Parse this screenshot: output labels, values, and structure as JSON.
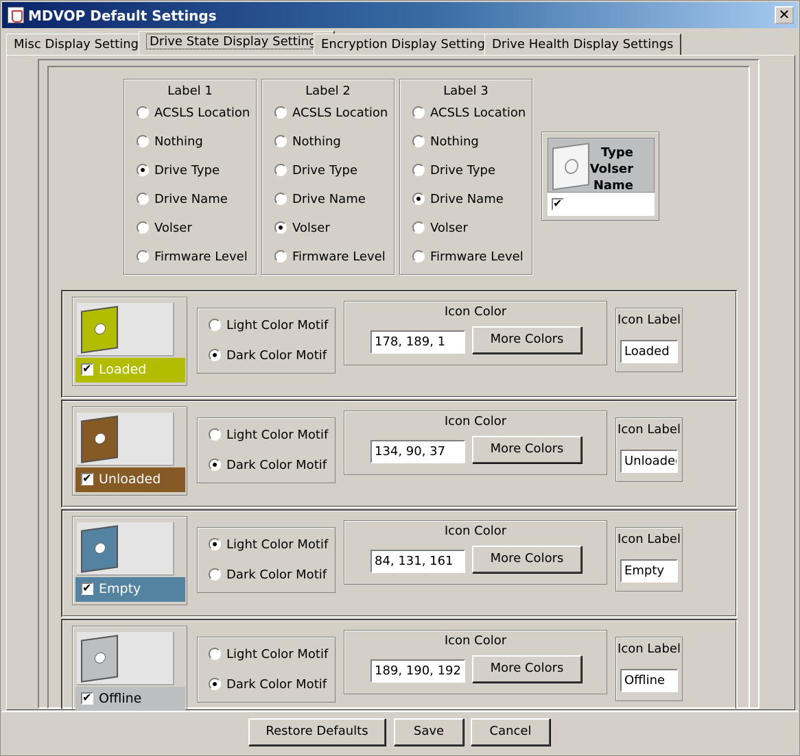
{
  "window": {
    "title": "MDVOP Default Settings",
    "close_glyph": "✕"
  },
  "tabs": [
    {
      "label": "Misc Display Settings",
      "active": false
    },
    {
      "label": "Drive State Display Settings",
      "active": true
    },
    {
      "label": "Encryption Display Settings",
      "active": false
    },
    {
      "label": "Drive Health Display Settings",
      "active": false
    }
  ],
  "label_groups": [
    {
      "title": "Label 1",
      "options": [
        "ACSLS Location",
        "Nothing",
        "Drive Type",
        "Drive Name",
        "Volser",
        "Firmware Level"
      ],
      "selected": "Drive Type"
    },
    {
      "title": "Label 2",
      "options": [
        "ACSLS Location",
        "Nothing",
        "Drive Type",
        "Drive Name",
        "Volser",
        "Firmware Level"
      ],
      "selected": "Volser"
    },
    {
      "title": "Label 3",
      "options": [
        "ACSLS Location",
        "Nothing",
        "Drive Type",
        "Drive Name",
        "Volser",
        "Firmware Level"
      ],
      "selected": "Drive Name"
    }
  ],
  "preview": {
    "lines": [
      "Type",
      "Volser",
      "Name"
    ],
    "checked": true
  },
  "motif_labels": {
    "light": "Light Color Motif",
    "dark": "Dark Color Motif"
  },
  "icon_color_title": "Icon Color",
  "icon_label_title": "Icon Label",
  "more_colors_label": "More Colors",
  "states": [
    {
      "name": "Loaded",
      "checked": true,
      "motif": "dark",
      "rgb": "178, 189, 1",
      "color": "#b2bd01",
      "icon_label": "Loaded"
    },
    {
      "name": "Unloaded",
      "checked": true,
      "motif": "dark",
      "rgb": "134, 90, 37",
      "color": "#865a25",
      "icon_label": "Unloaded"
    },
    {
      "name": "Empty",
      "checked": true,
      "motif": "light",
      "rgb": "84, 131, 161",
      "color": "#5483a1",
      "icon_label": "Empty"
    },
    {
      "name": "Offline",
      "checked": true,
      "motif": "dark",
      "rgb": "189, 190, 192",
      "color": "#bdbec0",
      "icon_label": "Offline"
    }
  ],
  "footer": {
    "restore_label": "Restore Defaults",
    "save_label": "Save",
    "cancel_label": "Cancel"
  }
}
